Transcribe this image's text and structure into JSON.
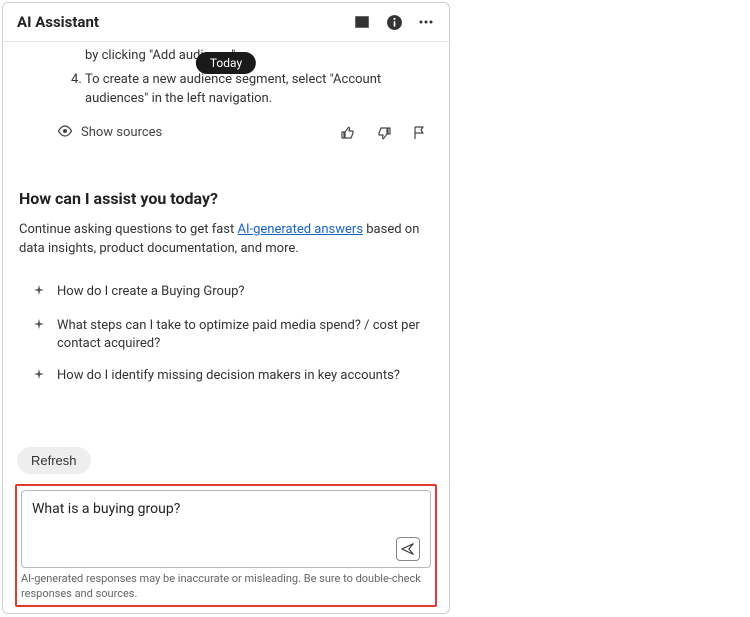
{
  "header": {
    "title": "AI Assistant"
  },
  "badge": {
    "today": "Today"
  },
  "answer": {
    "item3_prefix": "by clicking \"Add audience\"",
    "item4": "To create a new audience segment, select \"Account audiences\" in the left navigation."
  },
  "sources": {
    "show": "Show sources"
  },
  "assist": {
    "heading": "How can I assist you today?",
    "sub_prefix": "Continue asking questions to get fast ",
    "sub_link": "AI-generated answers",
    "sub_suffix": " based on data insights, product documentation, and more."
  },
  "suggestions": [
    "How do I create a Buying Group?",
    "What steps can I take to optimize paid media spend? / cost per contact acquired?",
    "How do I identify missing decision makers in key accounts?"
  ],
  "refresh": {
    "label": "Refresh"
  },
  "input": {
    "value": "What is a buying group?",
    "disclaimer": "AI-generated responses may be inaccurate or misleading. Be sure to double-check responses and sources."
  }
}
